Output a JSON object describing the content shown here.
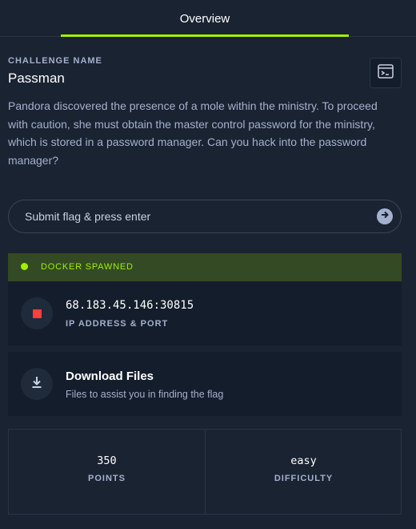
{
  "tabs": [
    {
      "label": "Overview",
      "active": true
    }
  ],
  "challenge": {
    "label": "CHALLENGE NAME",
    "name": "Passman",
    "description": "Pandora discovered the presence of a mole within the ministry. To proceed with caution, she must obtain the master control password for the ministry, which is stored in a password manager. Can you hack into the password manager?"
  },
  "flag": {
    "placeholder": "Submit flag & press enter",
    "value": ""
  },
  "docker": {
    "status": "DOCKER SPAWNED",
    "address": "68.183.45.146:30815",
    "address_label": "IP ADDRESS & PORT"
  },
  "download": {
    "title": "Download Files",
    "subtitle": "Files to assist you in finding the flag"
  },
  "stats": {
    "points": "350",
    "points_label": "POINTS",
    "difficulty": "easy",
    "difficulty_label": "DIFFICULTY"
  },
  "icons": {
    "terminal": "terminal-icon",
    "submit": "arrow-right-circle-icon",
    "stop": "stop-icon",
    "download": "download-icon",
    "status_dot": "status-dot-icon"
  },
  "colors": {
    "background": "#1a2332",
    "card": "#141d2b",
    "accent": "#9fef00",
    "docker_bar": "#344a24",
    "stop": "#ff3e3e",
    "muted_text": "#a4b1cd"
  }
}
